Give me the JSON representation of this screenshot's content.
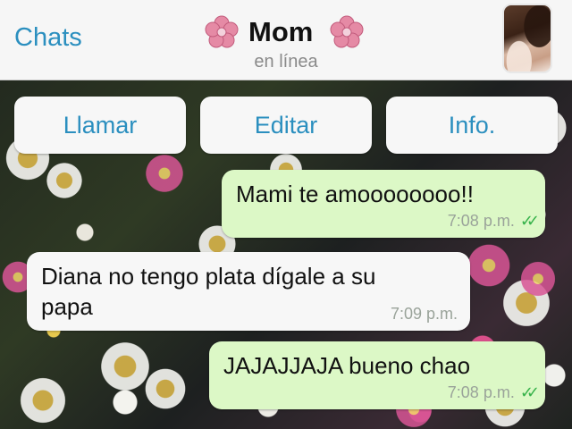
{
  "header": {
    "back_label": "Chats",
    "contact_name": "Mom",
    "status": "en línea"
  },
  "actions": {
    "call": "Llamar",
    "edit": "Editar",
    "info": "Info."
  },
  "messages": [
    {
      "direction": "outgoing",
      "text": "Mami te amoooooooo!!",
      "time": "7:08 p.m.",
      "ticks": "✓✓"
    },
    {
      "direction": "incoming",
      "text": "Diana no tengo plata dígale a su papa",
      "time": "7:09 p.m."
    },
    {
      "direction": "outgoing",
      "text": "JAJAJJAJA bueno chao",
      "time": "7:08 p.m.",
      "ticks": "✓✓"
    }
  ],
  "colors": {
    "accent": "#2b8fbf",
    "outgoing_bubble": "#dcf8c6",
    "incoming_bubble": "#f7f7f7",
    "read_ticks": "#36b24a"
  },
  "icons": {
    "title_decoration": "flower-icon",
    "avatar": "contact-avatar"
  }
}
